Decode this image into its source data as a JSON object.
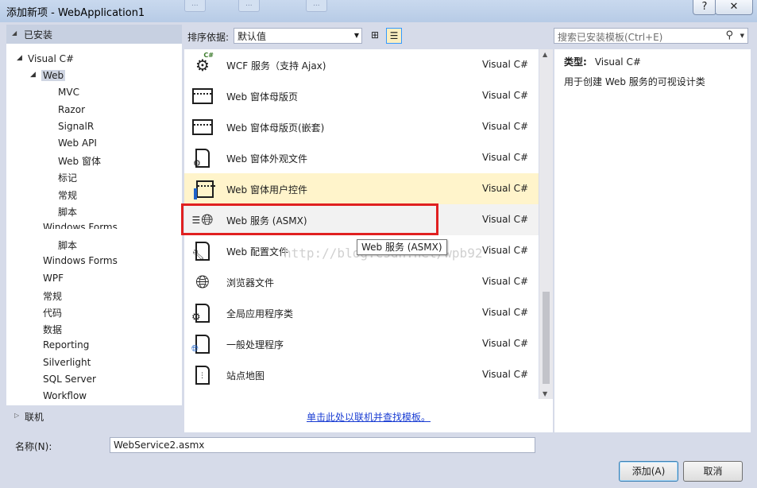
{
  "window": {
    "title": "添加新项 - WebApplication1",
    "help_label": "?",
    "close_label": "✕",
    "ghost_tabs": [
      "...",
      "...",
      "..."
    ]
  },
  "left": {
    "header": "已安装",
    "tree": [
      {
        "label": "Visual C#",
        "indent": 0,
        "expander": "◢"
      },
      {
        "label": "Web",
        "indent": 1,
        "expander": "◢",
        "selected": true
      },
      {
        "label": "MVC",
        "indent": 2
      },
      {
        "label": "Razor",
        "indent": 2
      },
      {
        "label": "SignalR",
        "indent": 2
      },
      {
        "label": "Web API",
        "indent": 2
      },
      {
        "label": "Web 窗体",
        "indent": 2
      },
      {
        "label": "标记",
        "indent": 2
      },
      {
        "label": "常规",
        "indent": 2
      },
      {
        "label": "脚本",
        "indent": 2
      },
      {
        "label": "Windows Forms",
        "indent": 1,
        "clipped": true
      },
      {
        "label": "脚本",
        "indent": 2
      },
      {
        "label": "Windows Forms",
        "indent": 1
      },
      {
        "label": "WPF",
        "indent": 1
      },
      {
        "label": "常规",
        "indent": 1
      },
      {
        "label": "代码",
        "indent": 1
      },
      {
        "label": "数据",
        "indent": 1
      },
      {
        "label": "Reporting",
        "indent": 1
      },
      {
        "label": "Silverlight",
        "indent": 1
      },
      {
        "label": "SQL Server",
        "indent": 1
      },
      {
        "label": "Workflow",
        "indent": 1
      }
    ],
    "online_label": "联机"
  },
  "toolbar": {
    "sort_label": "排序依据:",
    "sort_value": "默认值",
    "search_placeholder": "搜索已安装模板(Ctrl+E)"
  },
  "templates": [
    {
      "name": "WCF 服务（支持 Ajax)",
      "lang": "Visual C#",
      "icon": "wcf-ajax-icon"
    },
    {
      "name": "Web 窗体母版页",
      "lang": "Visual C#",
      "icon": "master-page-icon"
    },
    {
      "name": "Web 窗体母版页(嵌套)",
      "lang": "Visual C#",
      "icon": "nested-master-page-icon"
    },
    {
      "name": "Web 窗体外观文件",
      "lang": "Visual C#",
      "icon": "skin-file-icon"
    },
    {
      "name": "Web 窗体用户控件",
      "lang": "Visual C#",
      "icon": "user-control-icon",
      "state": "hover"
    },
    {
      "name": "Web 服务 (ASMX)",
      "lang": "Visual C#",
      "icon": "globe-service-icon",
      "state": "selected"
    },
    {
      "name": "Web 配置文件",
      "lang": "Visual C#",
      "icon": "config-file-icon"
    },
    {
      "name": "浏览器文件",
      "lang": "Visual C#",
      "icon": "browser-file-icon"
    },
    {
      "name": "全局应用程序类",
      "lang": "Visual C#",
      "icon": "global-app-icon"
    },
    {
      "name": "一般处理程序",
      "lang": "Visual C#",
      "icon": "handler-icon"
    },
    {
      "name": "站点地图",
      "lang": "Visual C#",
      "icon": "sitemap-icon"
    }
  ],
  "tooltip": "Web 服务 (ASMX)",
  "watermark": "http://blog.csdn.net/wpb92",
  "online_link": "单击此处以联机并查找模板。",
  "details": {
    "type_label": "类型:",
    "type_value": "Visual C#",
    "description": "用于创建 Web 服务的可视设计类"
  },
  "footer": {
    "name_label": "名称(N):",
    "name_value": "WebService2.asmx",
    "add_label": "添加(A)",
    "cancel_label": "取消"
  }
}
